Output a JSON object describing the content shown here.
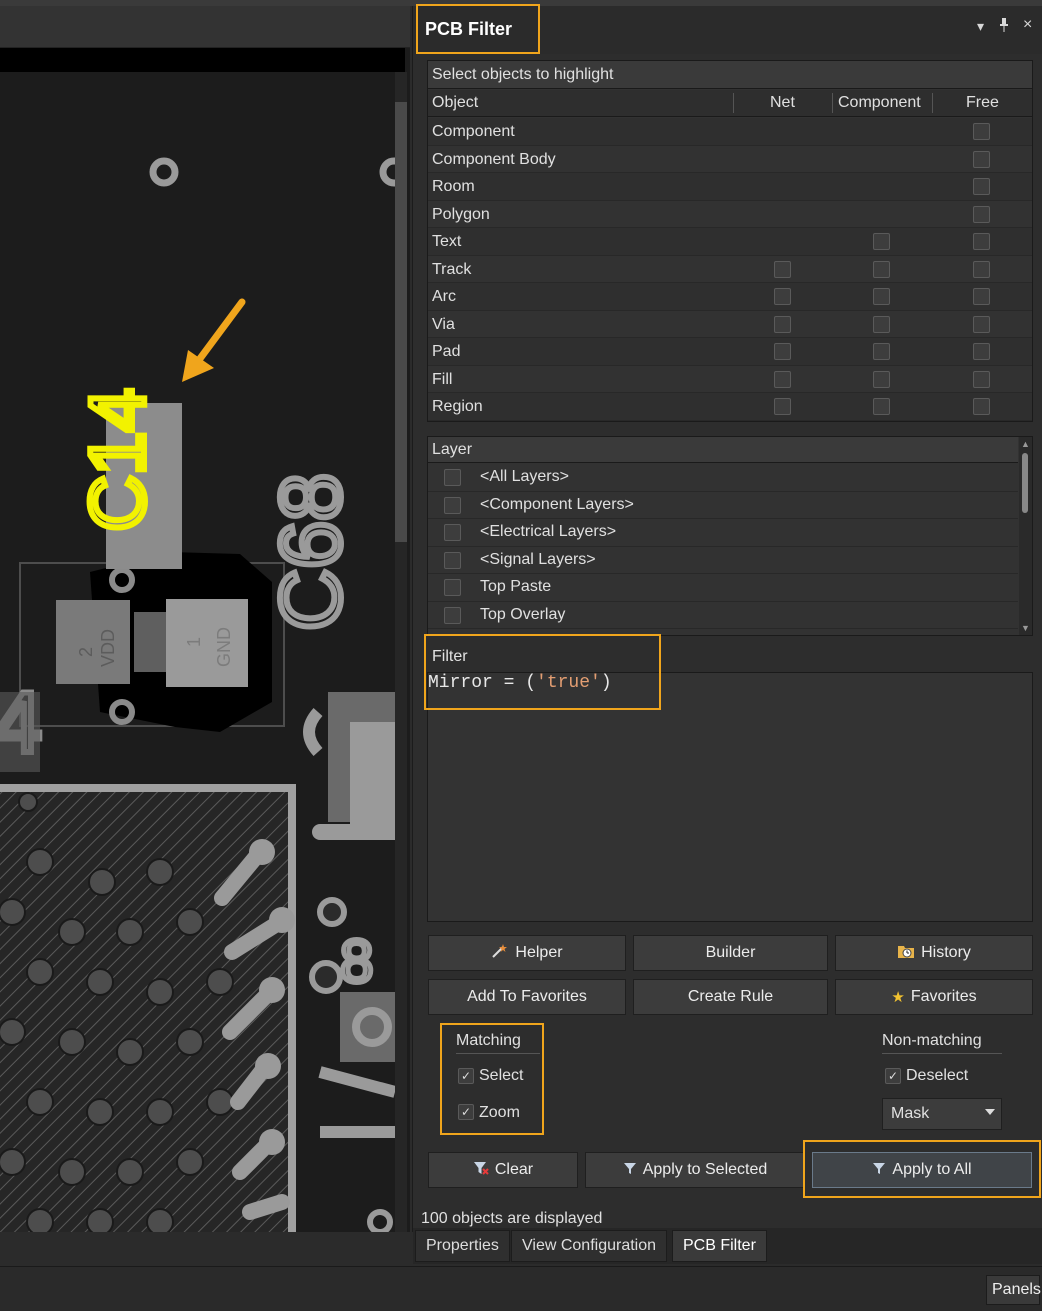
{
  "panel": {
    "title": "PCB Filter",
    "header_icons": {
      "dropdown": "▾",
      "pin": "pin-icon",
      "close": "×"
    }
  },
  "objects": {
    "title": "Select objects to highlight",
    "columns": [
      "Object",
      "Net",
      "Component",
      "Free"
    ],
    "rows": [
      {
        "label": "Component",
        "net": false,
        "component": false,
        "free": true
      },
      {
        "label": "Component Body",
        "net": false,
        "component": false,
        "free": true
      },
      {
        "label": "Room",
        "net": false,
        "component": false,
        "free": true
      },
      {
        "label": "Polygon",
        "net": false,
        "component": false,
        "free": true
      },
      {
        "label": "Text",
        "net": false,
        "component": true,
        "free": true
      },
      {
        "label": "Track",
        "net": true,
        "component": true,
        "free": true
      },
      {
        "label": "Arc",
        "net": true,
        "component": true,
        "free": true
      },
      {
        "label": "Via",
        "net": true,
        "component": true,
        "free": true
      },
      {
        "label": "Pad",
        "net": true,
        "component": true,
        "free": true
      },
      {
        "label": "Fill",
        "net": true,
        "component": true,
        "free": true
      },
      {
        "label": "Region",
        "net": true,
        "component": true,
        "free": true
      }
    ]
  },
  "layers": {
    "title": "Layer",
    "items": [
      "<All Layers>",
      "<Component Layers>",
      "<Electrical Layers>",
      "<Signal Layers>",
      "Top Paste",
      "Top Overlay"
    ]
  },
  "filter": {
    "label": "Filter",
    "expr_prefix": "Mirror = (",
    "expr_string": "'true'",
    "expr_suffix": ")"
  },
  "buttons": {
    "helper": "Helper",
    "builder": "Builder",
    "history": "History",
    "add_favorites": "Add To Favorites",
    "create_rule": "Create Rule",
    "favorites": "Favorites",
    "clear": "Clear",
    "apply_selected": "Apply to Selected",
    "apply_all": "Apply to All"
  },
  "matching": {
    "title": "Matching",
    "select_label": "Select",
    "select_checked": true,
    "zoom_label": "Zoom",
    "zoom_checked": true
  },
  "non_matching": {
    "title": "Non-matching",
    "deselect_label": "Deselect",
    "deselect_checked": true,
    "mode_value": "Mask"
  },
  "status": "100 objects are displayed",
  "tabs": [
    "Properties",
    "View Configuration",
    "PCB Filter"
  ],
  "active_tab": "PCB Filter",
  "bottom": {
    "panels_label": "Panels"
  },
  "pcb": {
    "designator_highlighted": "C14",
    "designator_other": "C68",
    "pad_labels": [
      "2",
      "VDD",
      "1",
      "GND"
    ],
    "partial_label": "4",
    "colors": {
      "highlight": "#f0a51c",
      "silk": "#f2f200",
      "copper": "#9a9a9a"
    }
  }
}
